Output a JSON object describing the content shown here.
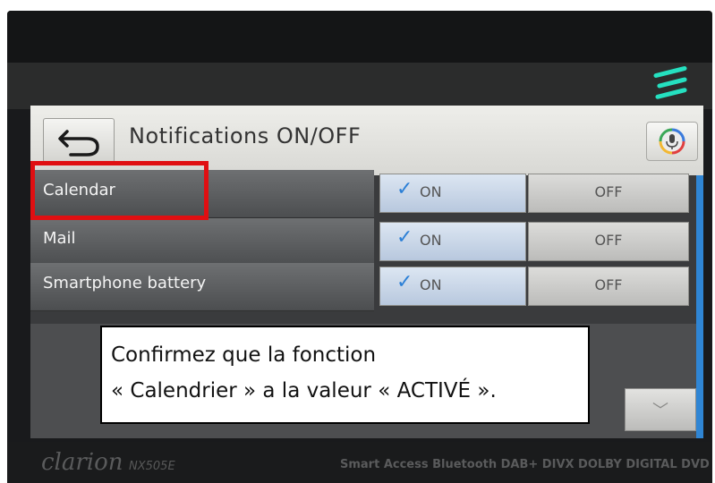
{
  "device": {
    "brand": "clarion",
    "model": "NX505E",
    "features": "Smart Access  Bluetooth  DAB+  DIVX  DOLBY DIGITAL  DVD"
  },
  "header": {
    "back_icon": "back-arrow-icon",
    "title": "Notifications ON/OFF",
    "voice_icon": "microphone-icon"
  },
  "rows": [
    {
      "label": "Calendar",
      "on_label": "ON",
      "off_label": "OFF",
      "selected": "ON"
    },
    {
      "label": "Mail",
      "on_label": "ON",
      "off_label": "OFF",
      "selected": "ON"
    },
    {
      "label": "Smartphone battery",
      "on_label": "ON",
      "off_label": "OFF",
      "selected": "ON"
    }
  ],
  "callout": {
    "line1": "Confirmez que la fonction",
    "line2": "« Calendrier » a la valeur « ACTIVÉ »."
  },
  "colors": {
    "highlight": "#e00f12",
    "check": "#2b7fd6",
    "scrollbar": "#2f85d4",
    "led": "#25e0c0"
  }
}
